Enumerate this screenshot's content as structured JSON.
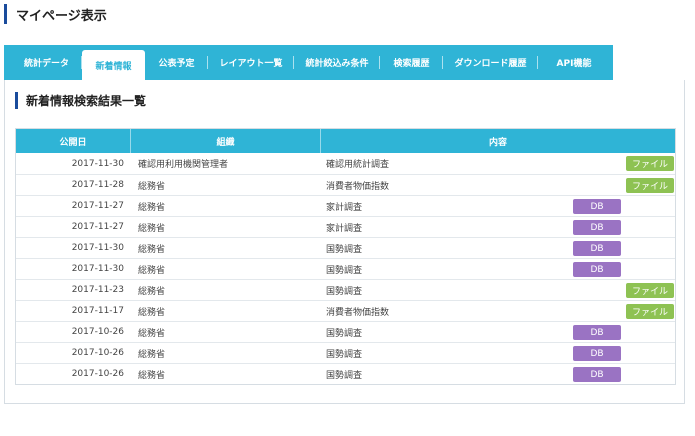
{
  "header": {
    "title": "マイページ表示"
  },
  "tabs": [
    {
      "label": "統計データ"
    },
    {
      "label": "新着情報"
    },
    {
      "label": "公表予定"
    },
    {
      "label": "レイアウト一覧"
    },
    {
      "label": "統計絞込み条件"
    },
    {
      "label": "検索履歴"
    },
    {
      "label": "ダウンロード履歴"
    },
    {
      "label": "API機能"
    }
  ],
  "section": {
    "title": "新着情報検索結果一覧"
  },
  "table": {
    "columns": {
      "date": "公開日",
      "org": "組織",
      "content": "内容"
    },
    "rows": [
      {
        "date": "2017-11-30",
        "org": "確認用利用機関管理者",
        "subject": "確認用統計調査",
        "button": "ファイル",
        "type": "file"
      },
      {
        "date": "2017-11-28",
        "org": "総務省",
        "subject": "消費者物価指数",
        "button": "ファイル",
        "type": "file"
      },
      {
        "date": "2017-11-27",
        "org": "総務省",
        "subject": "家計調査",
        "button": "DB",
        "type": "db"
      },
      {
        "date": "2017-11-27",
        "org": "総務省",
        "subject": "家計調査",
        "button": "DB",
        "type": "db"
      },
      {
        "date": "2017-11-30",
        "org": "総務省",
        "subject": "国勢調査",
        "button": "DB",
        "type": "db"
      },
      {
        "date": "2017-11-30",
        "org": "総務省",
        "subject": "国勢調査",
        "button": "DB",
        "type": "db"
      },
      {
        "date": "2017-11-23",
        "org": "総務省",
        "subject": "国勢調査",
        "button": "ファイル",
        "type": "file"
      },
      {
        "date": "2017-11-17",
        "org": "総務省",
        "subject": "消費者物価指数",
        "button": "ファイル",
        "type": "file"
      },
      {
        "date": "2017-10-26",
        "org": "総務省",
        "subject": "国勢調査",
        "button": "DB",
        "type": "db"
      },
      {
        "date": "2017-10-26",
        "org": "総務省",
        "subject": "国勢調査",
        "button": "DB",
        "type": "db"
      },
      {
        "date": "2017-10-26",
        "org": "総務省",
        "subject": "国勢調査",
        "button": "DB",
        "type": "db"
      }
    ]
  },
  "colors": {
    "accent": "#2fb4d6",
    "title_bar": "#1a4c9c",
    "db_button": "#9a73c3",
    "file_button": "#8ec253"
  }
}
